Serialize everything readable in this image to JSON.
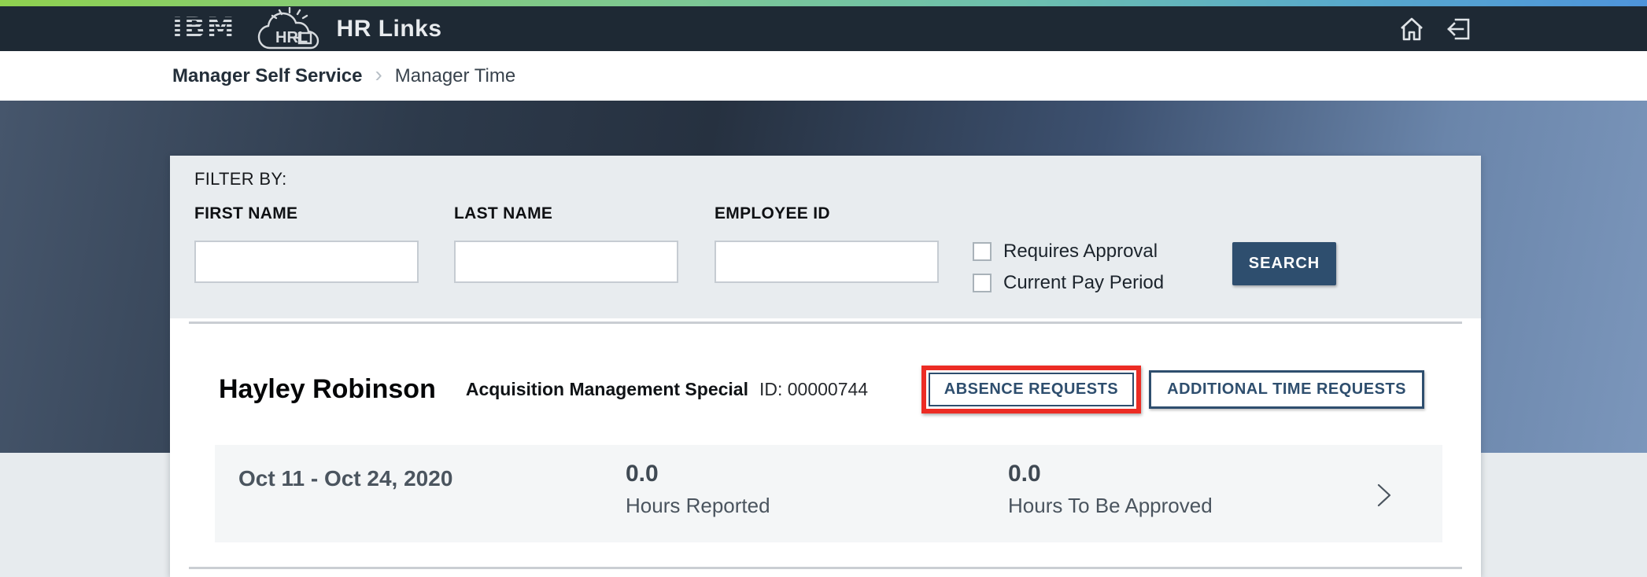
{
  "header": {
    "ibm_logo_text": "IBM",
    "product_name": "HR Links",
    "bg_color": "#1e2934",
    "accent_gradient": [
      "#8fd14f",
      "#7cc795",
      "#4e94db"
    ]
  },
  "breadcrumb": {
    "section": "Manager Self Service",
    "separator": "›",
    "page": "Manager Time"
  },
  "filter": {
    "title": "FILTER BY:",
    "fields": [
      {
        "label": "FIRST NAME",
        "value": "",
        "placeholder": ""
      },
      {
        "label": "LAST NAME",
        "value": "",
        "placeholder": ""
      },
      {
        "label": "EMPLOYEE ID",
        "value": "",
        "placeholder": ""
      }
    ],
    "checkboxes": [
      {
        "label": "Requires Approval",
        "checked": false
      },
      {
        "label": "Current Pay Period",
        "checked": false
      }
    ],
    "search_label": "SEARCH",
    "search_color": "#2e4e6e"
  },
  "employee": {
    "name": "Hayley Robinson",
    "job_title": "Acquisition Management Special",
    "id_text": "ID: 00000744",
    "buttons": [
      {
        "label": "ABSENCE REQUESTS",
        "highlighted": true
      },
      {
        "label": "ADDITIONAL TIME REQUESTS",
        "highlighted": false
      }
    ],
    "highlight_color": "#ec2c24"
  },
  "pay_periods": [
    {
      "date_range": "Oct 11 - Oct 24, 2020",
      "hours_reported_value": "0.0",
      "hours_reported_label": "Hours Reported",
      "hours_to_approve_value": "0.0",
      "hours_to_approve_label": "Hours To Be Approved"
    }
  ]
}
